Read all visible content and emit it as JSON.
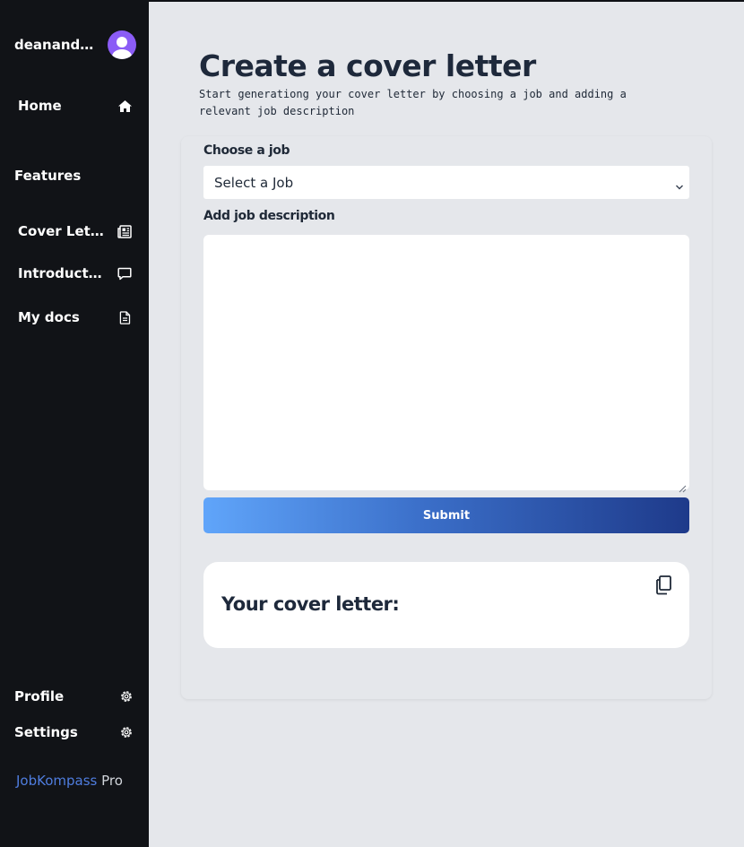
{
  "user": {
    "name": "deanand…"
  },
  "nav": {
    "home": "Home",
    "features_title": "Features",
    "items": [
      {
        "label": "Cover Lett…",
        "icon": "newspaper-icon"
      },
      {
        "label": "Introducti…",
        "icon": "chat-bubble-icon"
      },
      {
        "label": "My docs",
        "icon": "document-icon"
      }
    ],
    "profile": "Profile",
    "settings": "Settings"
  },
  "brand": {
    "primary": "JobKompass",
    "secondary": "Pro"
  },
  "page": {
    "title": "Create a cover letter",
    "subtitle": "Start generationg your cover letter by choosing a job and adding a relevant job description"
  },
  "form": {
    "job_label": "Choose a job",
    "job_selected": "Select a Job",
    "description_label": "Add job description",
    "description_value": "",
    "submit_label": "Submit"
  },
  "result": {
    "title": "Your cover letter:"
  },
  "colors": {
    "sidebar": "#111317",
    "accent": "#8b5cf6",
    "brand": "#4f7ddf",
    "gradient_start": "#60a5fa",
    "gradient_end": "#1e3a8a"
  }
}
